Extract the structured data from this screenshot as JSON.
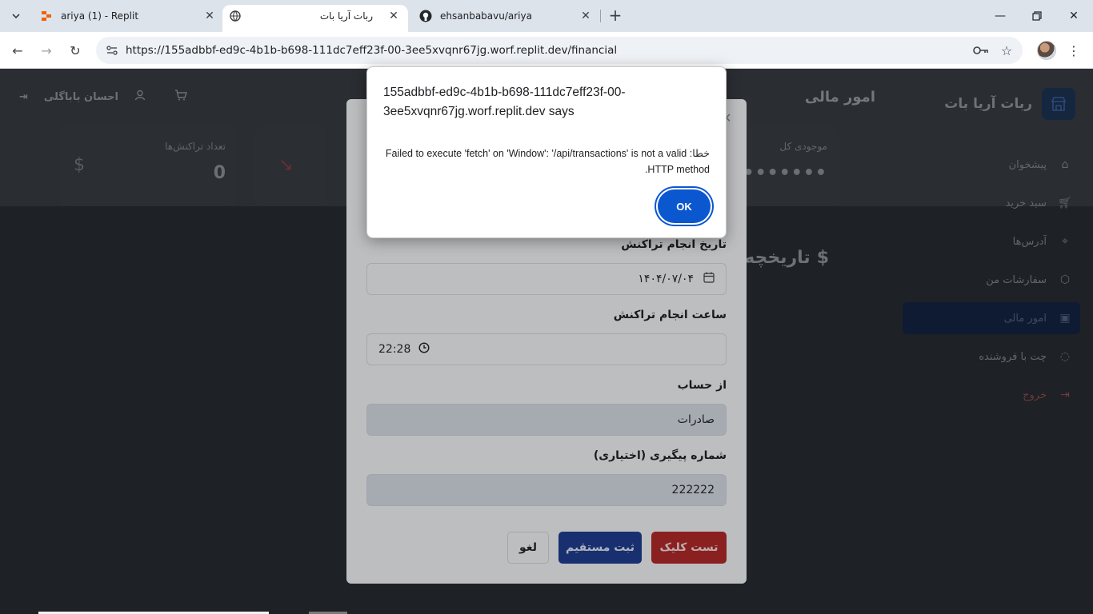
{
  "browser": {
    "tabs": [
      {
        "title": "ariya (1) - Replit",
        "favicon": "replit-icon"
      },
      {
        "title": "ربات آریا بات",
        "favicon": "globe-icon"
      },
      {
        "title": "ehsanbabavu/ariya",
        "favicon": "github-icon"
      }
    ],
    "url": "https://155adbbf-ed9c-4b1b-b698-111dc7eff23f-00-3ee5xvqnr67jg.worf.replit.dev/financial"
  },
  "app": {
    "brand": "ربات آریا بات",
    "page_title": "امور مالی",
    "user_name": "احسان باباگلی",
    "sidebar": [
      {
        "label": "پیشخوان",
        "icon": "home-icon"
      },
      {
        "label": "سبد خرید",
        "icon": "cart-icon"
      },
      {
        "label": "آدرس‌ها",
        "icon": "location-icon"
      },
      {
        "label": "سفارشات من",
        "icon": "box-icon"
      },
      {
        "label": "امور مالی",
        "icon": "wallet-icon"
      },
      {
        "label": "چت با فروشنده",
        "icon": "chat-icon"
      },
      {
        "label": "خروج",
        "icon": "logout-icon"
      }
    ],
    "stats": {
      "total_balance_label": "موجودی کل",
      "total_balance_value": "••••••••",
      "transactions_label": "تعداد تراکنش‌ها",
      "transactions_value": "0"
    },
    "history_title": "تاریخچه"
  },
  "modal": {
    "date_label": "تاریخ انجام تراکنش",
    "date_value": "۱۴۰۴/۰۷/۰۴",
    "time_label": "ساعت انجام تراکنش",
    "time_value": "22:28",
    "from_account_label": "از حساب",
    "from_account_value": "صادرات",
    "tracking_label": "شماره پیگیری (اختیاری)",
    "tracking_value": "222222",
    "test_button": "تست کلیک",
    "submit_button": "ثبت مستقیم",
    "cancel_button": "لغو"
  },
  "alert": {
    "origin": "155adbbf-ed9c-4b1b-b698-111dc7eff23f-00-3ee5xvqnr67jg.worf.replit.dev says",
    "message": "خطا: Failed to execute 'fetch' on 'Window': '/api/transactions' is not a valid HTTP method.",
    "ok_label": "OK"
  }
}
